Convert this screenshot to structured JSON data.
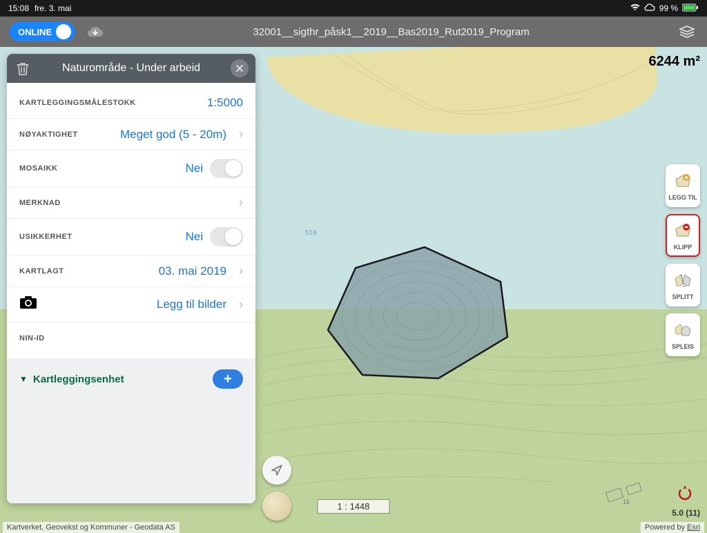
{
  "status": {
    "time": "15:08",
    "date": "fre. 3. mai",
    "battery": "99 %"
  },
  "toolbar": {
    "online_label": "ONLINE",
    "title": "32001__sigthr_påsk1__2019__Bas2019_Rut2019_Program"
  },
  "panel": {
    "title": "Naturområde - Under arbeid",
    "rows": {
      "scale_label": "KARTLEGGINGSMÅLESTOKK",
      "scale_value": "1:5000",
      "accuracy_label": "NØYAKTIGHET",
      "accuracy_value": "Meget god (5 - 20m)",
      "mosaic_label": "MOSAIKK",
      "mosaic_value": "Nei",
      "note_label": "MERKNAD",
      "uncertainty_label": "USIKKERHET",
      "uncertainty_value": "Nei",
      "mapped_label": "KARTLAGT",
      "mapped_value": "03. mai 2019",
      "photos_action": "Legg til bilder",
      "nin_label": "NIN-ID"
    },
    "section": {
      "title": "Kartleggingsenhet"
    }
  },
  "map": {
    "area": "6244 m²",
    "depth_label": "518",
    "scale": "1 : 1448",
    "compass": "5.0 (11)"
  },
  "tools": {
    "add": "LEGG TIL",
    "clip": "KLIPP",
    "split": "SPLITT",
    "merge": "SPLEIS"
  },
  "attribution": {
    "left": "Kartverket, Geovekst og Kommuner - Geodata AS",
    "right_prefix": "Powered by ",
    "right_link": "Esri"
  }
}
